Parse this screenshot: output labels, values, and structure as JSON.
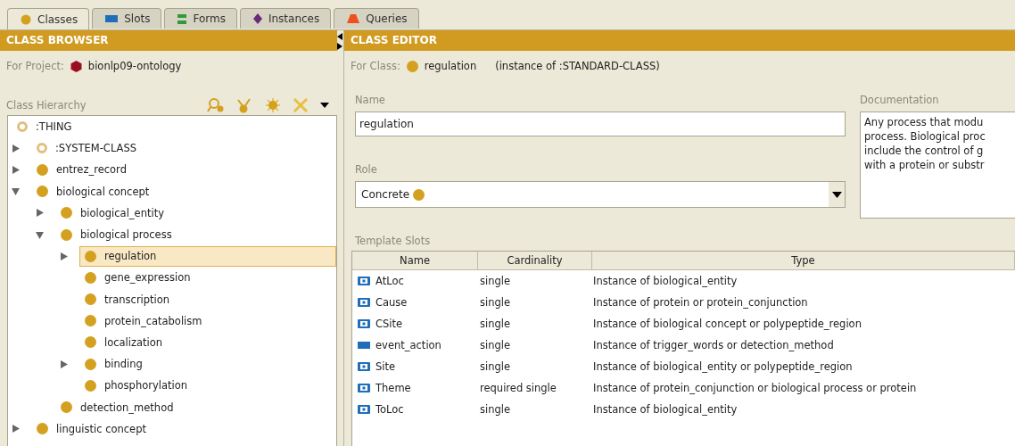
{
  "tabs": [
    {
      "label": "Classes",
      "kind": "classes",
      "selected": true
    },
    {
      "label": "Slots",
      "kind": "slots",
      "selected": false
    },
    {
      "label": "Forms",
      "kind": "forms",
      "selected": false
    },
    {
      "label": "Instances",
      "kind": "instances",
      "selected": false
    },
    {
      "label": "Queries",
      "kind": "queries",
      "selected": false
    }
  ],
  "class_browser": {
    "title": "CLASS BROWSER",
    "project_label": "For Project:",
    "project": "bionlp09-ontology",
    "hierarchy_label": "Class Hierarchy",
    "tree": [
      {
        "label": ":THING",
        "kind": "system",
        "selected": false,
        "children": [
          {
            "label": ":SYSTEM-CLASS",
            "kind": "system",
            "selected": false,
            "expanded": false
          },
          {
            "label": "entrez_record",
            "kind": "class",
            "selected": false,
            "expanded": false
          },
          {
            "label": "biological concept",
            "kind": "class",
            "selected": false,
            "expanded": true,
            "children": [
              {
                "label": "biological_entity",
                "kind": "class",
                "selected": false,
                "expanded": false
              },
              {
                "label": "biological process",
                "kind": "class",
                "selected": false,
                "expanded": true,
                "children": [
                  {
                    "label": "regulation",
                    "kind": "class",
                    "selected": true,
                    "expanded": false
                  },
                  {
                    "label": "gene_expression",
                    "kind": "class",
                    "selected": false
                  },
                  {
                    "label": "transcription",
                    "kind": "class",
                    "selected": false
                  },
                  {
                    "label": "protein_catabolism",
                    "kind": "class",
                    "selected": false
                  },
                  {
                    "label": "localization",
                    "kind": "class",
                    "selected": false
                  },
                  {
                    "label": "binding",
                    "kind": "class",
                    "selected": false,
                    "expanded": false
                  },
                  {
                    "label": "phosphorylation",
                    "kind": "class",
                    "selected": false
                  }
                ]
              },
              {
                "label": "detection_method",
                "kind": "class",
                "selected": false
              }
            ]
          },
          {
            "label": "linguistic concept",
            "kind": "class",
            "selected": false,
            "expanded": false
          }
        ]
      }
    ]
  },
  "class_editor": {
    "title": "CLASS EDITOR",
    "class_label": "For Class:",
    "class_name": "regulation",
    "instance_of": "(instance of :STANDARD-CLASS)",
    "name_label": "Name",
    "name_value": "regulation",
    "role_label": "Role",
    "role_value": "Concrete",
    "documentation_label": "Documentation",
    "documentation_lines": [
      "Any process that modu",
      "process. Biological proc",
      "include the control of g",
      "with a protein or substr"
    ],
    "template_slots_label": "Template Slots",
    "columns": [
      "Name",
      "Cardinality",
      "Type"
    ],
    "slots": [
      {
        "name": "AtLoc",
        "kind": "instance",
        "cardinality": "single",
        "type": "Instance of biological_entity"
      },
      {
        "name": "Cause",
        "kind": "instance",
        "cardinality": "single",
        "type": "Instance of protein or protein_conjunction"
      },
      {
        "name": "CSite",
        "kind": "instance",
        "cardinality": "single",
        "type": "Instance of biological concept or polypeptide_region"
      },
      {
        "name": "event_action",
        "kind": "plain",
        "cardinality": "single",
        "type": "Instance of trigger_words or detection_method"
      },
      {
        "name": "Site",
        "kind": "instance",
        "cardinality": "single",
        "type": "Instance of biological_entity or polypeptide_region"
      },
      {
        "name": "Theme",
        "kind": "instance",
        "cardinality": "required single",
        "type": "Instance of protein_conjunction or biological process or protein"
      },
      {
        "name": "ToLoc",
        "kind": "instance",
        "cardinality": "single",
        "type": "Instance of biological_entity"
      }
    ]
  }
}
